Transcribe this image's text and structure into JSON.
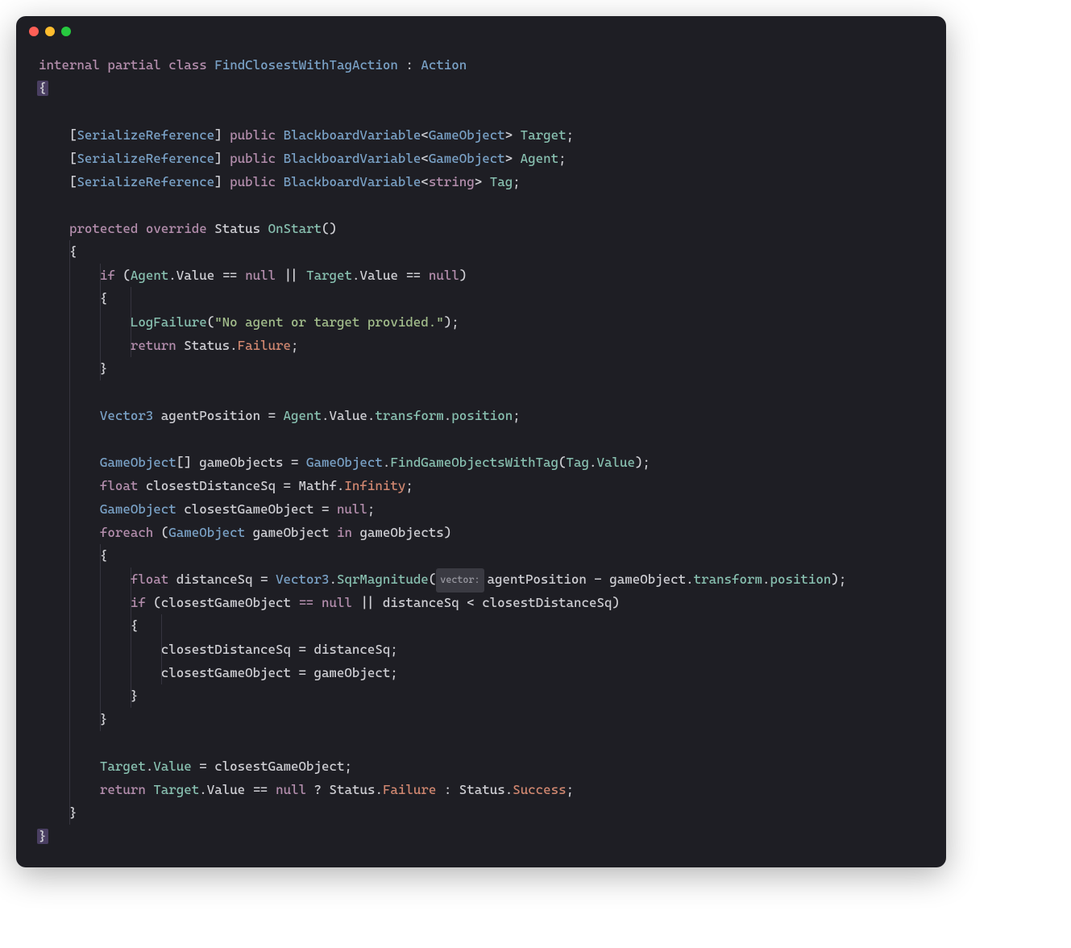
{
  "window": {
    "dots": [
      "red",
      "yellow",
      "green"
    ]
  },
  "code": {
    "lines": [
      [
        {
          "t": "internal",
          "c": "kw"
        },
        {
          "t": " ",
          "c": "punc"
        },
        {
          "t": "partial",
          "c": "kw"
        },
        {
          "t": " ",
          "c": "punc"
        },
        {
          "t": "class",
          "c": "kw"
        },
        {
          "t": " ",
          "c": "punc"
        },
        {
          "t": "FindClosestWithTagAction",
          "c": "type"
        },
        {
          "t": " : ",
          "c": "punc"
        },
        {
          "t": "Action",
          "c": "type"
        }
      ],
      [
        {
          "t": "{",
          "c": "punc hi-br"
        }
      ],
      [],
      [
        {
          "t": "    [",
          "c": "punc"
        },
        {
          "t": "SerializeReference",
          "c": "attr"
        },
        {
          "t": "] ",
          "c": "punc"
        },
        {
          "t": "public",
          "c": "kw"
        },
        {
          "t": " ",
          "c": "punc"
        },
        {
          "t": "BlackboardVariable",
          "c": "type"
        },
        {
          "t": "<",
          "c": "punc"
        },
        {
          "t": "GameObject",
          "c": "type"
        },
        {
          "t": "> ",
          "c": "punc"
        },
        {
          "t": "Target",
          "c": "prop"
        },
        {
          "t": ";",
          "c": "punc"
        }
      ],
      [
        {
          "t": "    [",
          "c": "punc"
        },
        {
          "t": "SerializeReference",
          "c": "attr"
        },
        {
          "t": "] ",
          "c": "punc"
        },
        {
          "t": "public",
          "c": "kw"
        },
        {
          "t": " ",
          "c": "punc"
        },
        {
          "t": "BlackboardVariable",
          "c": "type"
        },
        {
          "t": "<",
          "c": "punc"
        },
        {
          "t": "GameObject",
          "c": "type"
        },
        {
          "t": "> ",
          "c": "punc"
        },
        {
          "t": "Agent",
          "c": "prop"
        },
        {
          "t": ";",
          "c": "punc"
        }
      ],
      [
        {
          "t": "    [",
          "c": "punc"
        },
        {
          "t": "SerializeReference",
          "c": "attr"
        },
        {
          "t": "] ",
          "c": "punc"
        },
        {
          "t": "public",
          "c": "kw"
        },
        {
          "t": " ",
          "c": "punc"
        },
        {
          "t": "BlackboardVariable",
          "c": "type"
        },
        {
          "t": "<",
          "c": "punc"
        },
        {
          "t": "string",
          "c": "kw"
        },
        {
          "t": "> ",
          "c": "punc"
        },
        {
          "t": "Tag",
          "c": "prop"
        },
        {
          "t": ";",
          "c": "punc"
        }
      ],
      [],
      [
        {
          "t": "    ",
          "c": "punc"
        },
        {
          "t": "protected",
          "c": "kw"
        },
        {
          "t": " ",
          "c": "punc"
        },
        {
          "t": "override",
          "c": "kw"
        },
        {
          "t": " ",
          "c": "punc"
        },
        {
          "t": "Status",
          "c": "ident"
        },
        {
          "t": " ",
          "c": "punc"
        },
        {
          "t": "OnStart",
          "c": "method"
        },
        {
          "t": "()",
          "c": "punc"
        }
      ],
      [
        {
          "t": "    {",
          "c": "punc"
        }
      ],
      [
        {
          "t": "        ",
          "c": "punc"
        },
        {
          "t": "if",
          "c": "kw"
        },
        {
          "t": " (",
          "c": "punc"
        },
        {
          "t": "Agent",
          "c": "prop"
        },
        {
          "t": ".",
          "c": "punc"
        },
        {
          "t": "Value",
          "c": "ident"
        },
        {
          "t": " == ",
          "c": "punc"
        },
        {
          "t": "null",
          "c": "kw"
        },
        {
          "t": " || ",
          "c": "punc"
        },
        {
          "t": "Target",
          "c": "prop"
        },
        {
          "t": ".",
          "c": "punc"
        },
        {
          "t": "Value",
          "c": "ident"
        },
        {
          "t": " == ",
          "c": "punc"
        },
        {
          "t": "null",
          "c": "kw"
        },
        {
          "t": ")",
          "c": "punc"
        }
      ],
      [
        {
          "t": "        {",
          "c": "punc"
        }
      ],
      [
        {
          "t": "            ",
          "c": "punc"
        },
        {
          "t": "LogFailure",
          "c": "method"
        },
        {
          "t": "(",
          "c": "punc"
        },
        {
          "t": "\"No agent or target provided.\"",
          "c": "str"
        },
        {
          "t": ");",
          "c": "punc"
        }
      ],
      [
        {
          "t": "            ",
          "c": "punc"
        },
        {
          "t": "return",
          "c": "kw"
        },
        {
          "t": " Status.",
          "c": "punc"
        },
        {
          "t": "Failure",
          "c": "propC"
        },
        {
          "t": ";",
          "c": "punc"
        }
      ],
      [
        {
          "t": "        }",
          "c": "punc"
        }
      ],
      [],
      [
        {
          "t": "        ",
          "c": "punc"
        },
        {
          "t": "Vector3",
          "c": "type"
        },
        {
          "t": " agentPosition = ",
          "c": "punc"
        },
        {
          "t": "Agent",
          "c": "prop"
        },
        {
          "t": ".",
          "c": "punc"
        },
        {
          "t": "Value",
          "c": "ident"
        },
        {
          "t": ".",
          "c": "punc"
        },
        {
          "t": "transform",
          "c": "prop"
        },
        {
          "t": ".",
          "c": "punc"
        },
        {
          "t": "position",
          "c": "prop"
        },
        {
          "t": ";",
          "c": "punc"
        }
      ],
      [],
      [
        {
          "t": "        ",
          "c": "punc"
        },
        {
          "t": "GameObject",
          "c": "type"
        },
        {
          "t": "[] gameObjects = ",
          "c": "punc"
        },
        {
          "t": "GameObject",
          "c": "type"
        },
        {
          "t": ".",
          "c": "punc"
        },
        {
          "t": "FindGameObjectsWithTag",
          "c": "method"
        },
        {
          "t": "(",
          "c": "punc"
        },
        {
          "t": "Tag",
          "c": "prop"
        },
        {
          "t": ".",
          "c": "punc"
        },
        {
          "t": "Value",
          "c": "prop"
        },
        {
          "t": ");",
          "c": "punc"
        }
      ],
      [
        {
          "t": "        ",
          "c": "punc"
        },
        {
          "t": "float",
          "c": "kw"
        },
        {
          "t": " closestDistanceSq = Mathf.",
          "c": "punc"
        },
        {
          "t": "Infinity",
          "c": "propC"
        },
        {
          "t": ";",
          "c": "punc"
        }
      ],
      [
        {
          "t": "        ",
          "c": "punc"
        },
        {
          "t": "GameObject",
          "c": "type"
        },
        {
          "t": " closestGameObject = ",
          "c": "punc"
        },
        {
          "t": "null",
          "c": "kw"
        },
        {
          "t": ";",
          "c": "punc"
        }
      ],
      [
        {
          "t": "        ",
          "c": "punc"
        },
        {
          "t": "foreach",
          "c": "kw"
        },
        {
          "t": " (",
          "c": "punc"
        },
        {
          "t": "GameObject",
          "c": "type"
        },
        {
          "t": " gameObject ",
          "c": "punc"
        },
        {
          "t": "in",
          "c": "kw"
        },
        {
          "t": " gameObjects)",
          "c": "punc"
        }
      ],
      [
        {
          "t": "        {",
          "c": "punc"
        }
      ],
      [
        {
          "t": "            ",
          "c": "punc"
        },
        {
          "t": "float",
          "c": "kw"
        },
        {
          "t": " distanceSq = ",
          "c": "punc"
        },
        {
          "t": "Vector3",
          "c": "type"
        },
        {
          "t": ".",
          "c": "punc"
        },
        {
          "t": "SqrMagnitude",
          "c": "method"
        },
        {
          "t": "(",
          "c": "punc"
        },
        {
          "t": "vector:",
          "c": "hint",
          "hint": true
        },
        {
          "t": "agentPosition - gameObject.",
          "c": "punc"
        },
        {
          "t": "transform",
          "c": "prop"
        },
        {
          "t": ".",
          "c": "punc"
        },
        {
          "t": "position",
          "c": "prop"
        },
        {
          "t": ");",
          "c": "punc"
        }
      ],
      [
        {
          "t": "            ",
          "c": "punc"
        },
        {
          "t": "if",
          "c": "kw"
        },
        {
          "t": " (closestGameObject ",
          "c": "punc"
        },
        {
          "t": "==",
          "c": "kw"
        },
        {
          "t": " ",
          "c": "punc"
        },
        {
          "t": "null",
          "c": "kw"
        },
        {
          "t": " || distanceSq < closestDistanceSq)",
          "c": "punc"
        }
      ],
      [
        {
          "t": "            {",
          "c": "punc"
        }
      ],
      [
        {
          "t": "                closestDistanceSq = distanceSq;",
          "c": "punc"
        }
      ],
      [
        {
          "t": "                closestGameObject = gameObject;",
          "c": "punc"
        }
      ],
      [
        {
          "t": "            }",
          "c": "punc"
        }
      ],
      [
        {
          "t": "        }",
          "c": "punc"
        }
      ],
      [],
      [
        {
          "t": "        ",
          "c": "punc"
        },
        {
          "t": "Target",
          "c": "prop"
        },
        {
          "t": ".",
          "c": "punc"
        },
        {
          "t": "Value",
          "c": "prop"
        },
        {
          "t": " = closestGameObject;",
          "c": "punc"
        }
      ],
      [
        {
          "t": "        ",
          "c": "punc"
        },
        {
          "t": "return",
          "c": "kw"
        },
        {
          "t": " ",
          "c": "punc"
        },
        {
          "t": "Target",
          "c": "prop"
        },
        {
          "t": ".",
          "c": "punc"
        },
        {
          "t": "Value",
          "c": "ident"
        },
        {
          "t": " == ",
          "c": "punc"
        },
        {
          "t": "null",
          "c": "kw"
        },
        {
          "t": " ? Status.",
          "c": "punc"
        },
        {
          "t": "Failure",
          "c": "propC"
        },
        {
          "t": " : Status.",
          "c": "punc"
        },
        {
          "t": "Success",
          "c": "propC"
        },
        {
          "t": ";",
          "c": "punc"
        }
      ],
      [
        {
          "t": "    }",
          "c": "punc"
        }
      ],
      [
        {
          "t": "}",
          "c": "punc hi-br"
        }
      ]
    ],
    "guides": [
      {
        "col": 4,
        "from": 8,
        "to": 32
      },
      {
        "col": 8,
        "from": 9,
        "to": 13
      },
      {
        "col": 12,
        "from": 10,
        "to": 12
      },
      {
        "col": 8,
        "from": 21,
        "to": 28
      },
      {
        "col": 12,
        "from": 22,
        "to": 27
      },
      {
        "col": 16,
        "from": 24,
        "to": 26
      }
    ]
  }
}
